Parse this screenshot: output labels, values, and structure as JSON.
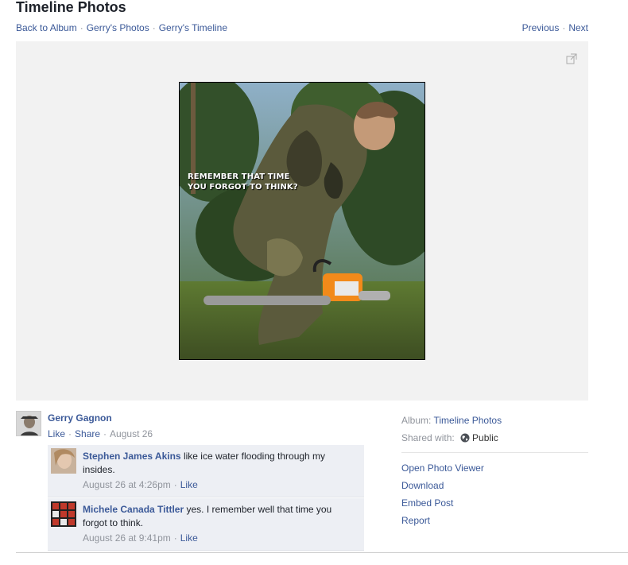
{
  "header": {
    "title": "Timeline Photos",
    "breadcrumbs": [
      "Back to Album",
      "Gerry's Photos",
      "Gerry's Timeline"
    ],
    "previous": "Previous",
    "next": "Next"
  },
  "photo": {
    "caption": "REMEMBER THAT TIME\nYOU FORGOT TO THINK?",
    "expand_icon": "expand-icon"
  },
  "owner": {
    "name": "Gerry Gagnon",
    "like": "Like",
    "share": "Share",
    "date": "August 26"
  },
  "comments": [
    {
      "name": "Stephen James Akins",
      "text": "like ice water flooding through my insides.",
      "time": "August 26 at 4:26pm",
      "like": "Like"
    },
    {
      "name": "Michele Canada Tittler",
      "text": "yes. I remember well that time you forgot to think.",
      "time": "August 26 at 9:41pm",
      "like": "Like"
    }
  ],
  "sidebar": {
    "album_label": "Album:",
    "album_value": "Timeline Photos",
    "shared_label": "Shared with:",
    "shared_value": "Public",
    "shared_icon": "globe-icon",
    "links": [
      "Open Photo Viewer",
      "Download",
      "Embed Post",
      "Report"
    ]
  },
  "colors": {
    "link": "#3b5998",
    "muted": "#90949c",
    "comment_bg": "#edeff4",
    "stage_bg": "#f2f2f2"
  }
}
